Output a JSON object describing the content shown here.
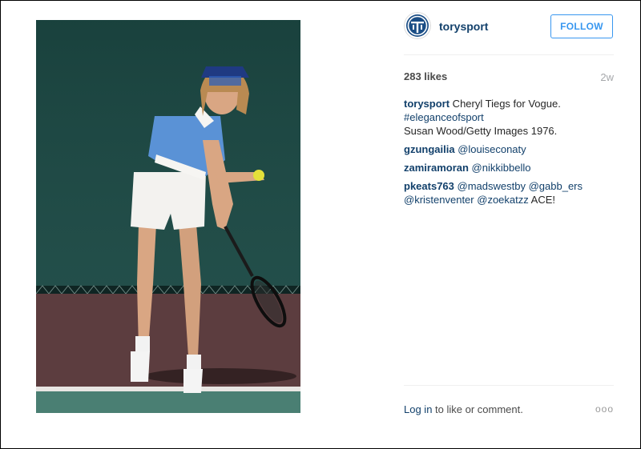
{
  "post": {
    "username": "torysport",
    "follow_label": "FOLLOW",
    "likes": "283 likes",
    "time_ago": "2w",
    "accent_color": "#3897f0",
    "link_color": "#12406b"
  },
  "caption": {
    "username": "torysport",
    "text_line1": " Cheryl Tiegs for Vogue.",
    "hashtag": "#eleganceofsport",
    "text_line2": "Susan Wood/Getty Images 1976."
  },
  "comments": [
    {
      "username": "gzungailia",
      "mention": "@louiseconaty",
      "text": ""
    },
    {
      "username": "zamiramoran",
      "mention": "@nikkibbello",
      "text": ""
    },
    {
      "username": "pkeats763",
      "mentions": [
        "@madswestby",
        "@gabb_ers",
        "@kristenventer",
        "@zoekatzz"
      ],
      "text": "ACE!"
    }
  ],
  "footer": {
    "login_label": "Log in",
    "rest_text": " to like or comment.",
    "more_icon": "ellipsis-icon",
    "more_text": "ooo"
  }
}
